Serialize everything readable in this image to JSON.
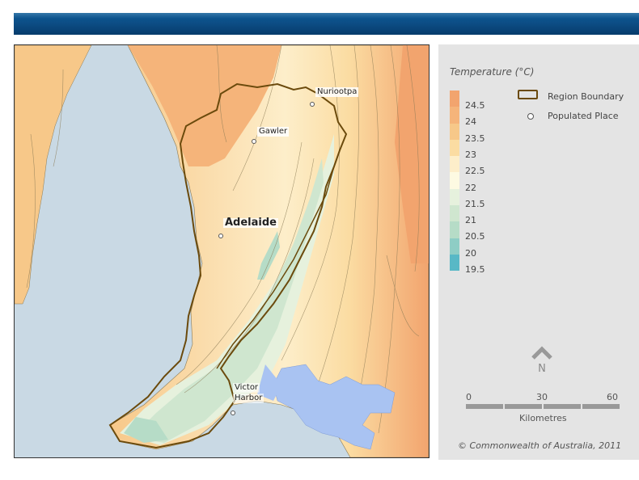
{
  "map": {
    "places": {
      "nuriootpa": "Nuriootpa",
      "gawler": "Gawler",
      "adelaide": "Adelaide",
      "victor_harbor_line1": "Victor",
      "victor_harbor_line2": "Harbor"
    },
    "colors": {
      "sea": "#c9d9e4",
      "lake": "#a9c3f2",
      "boundary": "#6b4a0c",
      "contour": "#8a7a55"
    }
  },
  "legend": {
    "title": "Temperature (°C)",
    "ticks": [
      "24.5",
      "24",
      "23.5",
      "23",
      "22.5",
      "22",
      "21.5",
      "21",
      "20.5",
      "20",
      "19.5"
    ],
    "ramp_colors": [
      "#f2a46e",
      "#f5b47a",
      "#f7c889",
      "#fbdca2",
      "#fdeeca",
      "#fdfae2",
      "#e6f1dd",
      "#cfe6cf",
      "#b6dcc7",
      "#8ecdc5",
      "#58b8c6"
    ],
    "region_boundary_label": "Region Boundary",
    "populated_place_label": "Populated Place",
    "north_label": "N",
    "scale": {
      "labels": [
        "0",
        "30",
        "60"
      ],
      "unit": "Kilometres"
    },
    "copyright": "© Commonwealth of Australia, 2011"
  }
}
